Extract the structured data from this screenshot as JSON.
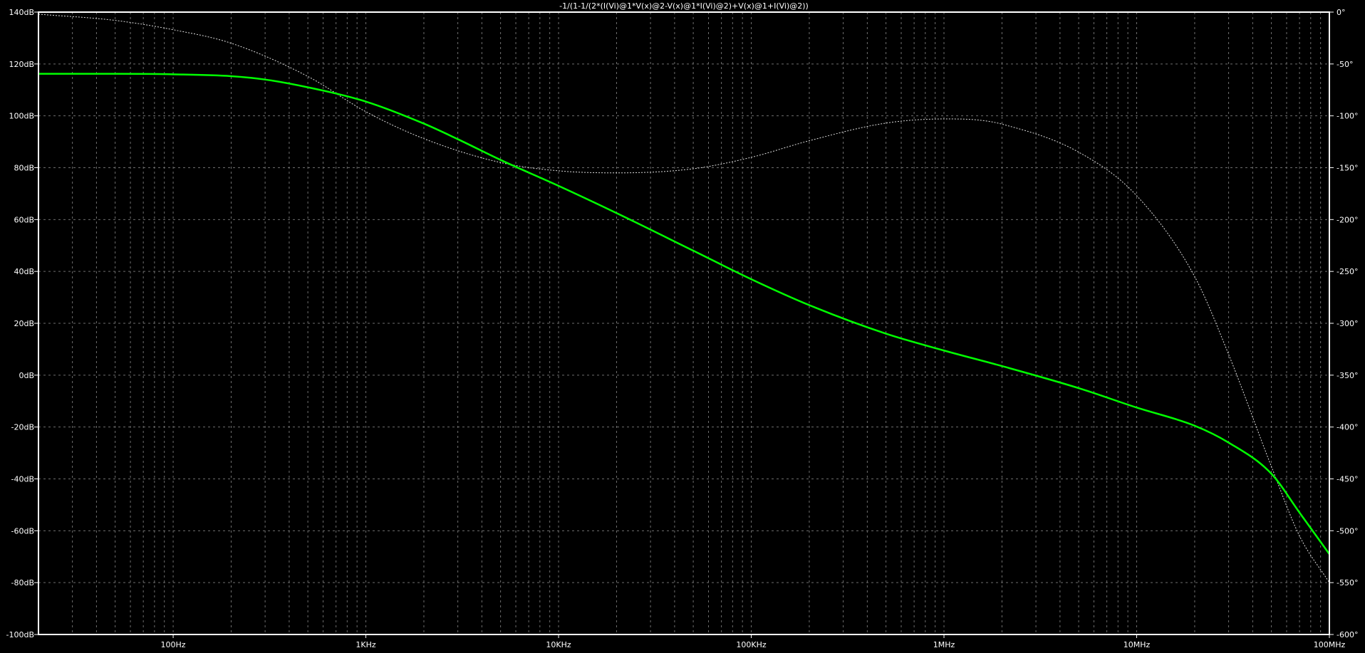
{
  "chart_data": {
    "type": "line",
    "title": "-1/(1-1/(2*(I(Vi)@1*V(x)@2-V(x)@1*I(Vi)@2)+V(x)@1+I(Vi)@2))",
    "x_scale": "log",
    "xlim": [
      20,
      100000000
    ],
    "x_ticks": [
      {
        "value": 100,
        "label": "100Hz"
      },
      {
        "value": 1000,
        "label": "1KHz"
      },
      {
        "value": 10000,
        "label": "10KHz"
      },
      {
        "value": 100000,
        "label": "100KHz"
      },
      {
        "value": 1000000,
        "label": "1MHz"
      },
      {
        "value": 10000000,
        "label": "10MHz"
      },
      {
        "value": 100000000,
        "label": "100MHz"
      }
    ],
    "y_left": {
      "lim": [
        -100,
        140
      ],
      "ticks": [
        140,
        120,
        100,
        80,
        60,
        40,
        20,
        0,
        -20,
        -40,
        -60,
        -80,
        -100
      ],
      "labels": [
        "140dB",
        "120dB",
        "100dB",
        "80dB",
        "60dB",
        "40dB",
        "20dB",
        "0dB",
        "-20dB",
        "-40dB",
        "-60dB",
        "-80dB",
        "-100dB"
      ]
    },
    "y_right": {
      "lim": [
        -600,
        0
      ],
      "ticks": [
        0,
        -50,
        -100,
        -150,
        -200,
        -250,
        -300,
        -350,
        -400,
        -450,
        -500,
        -550,
        -600
      ],
      "labels": [
        "0°",
        "-50°",
        "-100°",
        "-150°",
        "-200°",
        "-250°",
        "-300°",
        "-350°",
        "-400°",
        "-450°",
        "-500°",
        "-550°",
        "-600°"
      ]
    },
    "grid": true,
    "series": [
      {
        "kind": "magnitude",
        "axis": "left",
        "color": "#00ff00",
        "style": "solid",
        "points": [
          [
            20,
            116.2
          ],
          [
            50,
            116.2
          ],
          [
            100,
            116
          ],
          [
            200,
            115.3
          ],
          [
            300,
            114
          ],
          [
            500,
            111
          ],
          [
            1000,
            105.5
          ],
          [
            2000,
            97
          ],
          [
            3000,
            91
          ],
          [
            5000,
            83
          ],
          [
            10000,
            73
          ],
          [
            20000,
            62.5
          ],
          [
            50000,
            48
          ],
          [
            100000,
            37
          ],
          [
            200000,
            27
          ],
          [
            500000,
            16
          ],
          [
            1000000,
            9.5
          ],
          [
            2000000,
            3.5
          ],
          [
            5000000,
            -5
          ],
          [
            10000000,
            -12.5
          ],
          [
            20000000,
            -19.5
          ],
          [
            30000000,
            -26
          ],
          [
            50000000,
            -38
          ],
          [
            70000000,
            -53
          ],
          [
            100000000,
            -69
          ]
        ]
      },
      {
        "kind": "phase",
        "axis": "right",
        "color": "#dddddd",
        "style": "dotted",
        "points": [
          [
            20,
            -2
          ],
          [
            50,
            -8
          ],
          [
            100,
            -17
          ],
          [
            200,
            -30
          ],
          [
            500,
            -62
          ],
          [
            1000,
            -96
          ],
          [
            2000,
            -122
          ],
          [
            5000,
            -145
          ],
          [
            10000,
            -153
          ],
          [
            20000,
            -155
          ],
          [
            50000,
            -151
          ],
          [
            100000,
            -140
          ],
          [
            200000,
            -124
          ],
          [
            500000,
            -107
          ],
          [
            1000000,
            -103
          ],
          [
            1500000,
            -104
          ],
          [
            2000000,
            -108
          ],
          [
            5000000,
            -135
          ],
          [
            10000000,
            -177
          ],
          [
            20000000,
            -255
          ],
          [
            30000000,
            -330
          ],
          [
            50000000,
            -438
          ],
          [
            70000000,
            -505
          ],
          [
            100000000,
            -550
          ]
        ]
      }
    ]
  }
}
